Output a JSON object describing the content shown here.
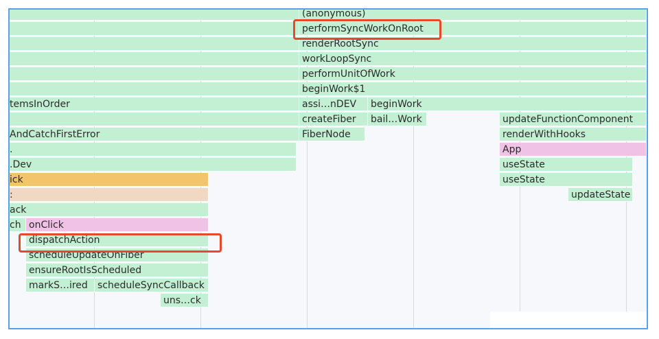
{
  "flame_chart": {
    "frames": {
      "anonymous": "(anonymous)",
      "performSyncWorkOnRoot": "performSyncWorkOnRoot",
      "renderRootSync": "renderRootSync",
      "workLoopSync": "workLoopSync",
      "performUnitOfWork": "performUnitOfWork",
      "beginWork1": "beginWork$1",
      "itemsInOrder": "temsInOrder",
      "assiNDEV": "assi…nDEV",
      "beginWork": "beginWork",
      "andCatchFirstError": "AndCatchFirstError",
      "createFiber": "createFiber",
      "bailWork": "bail…Work",
      "updateFunctionComponent": "updateFunctionComponent",
      "fiberNode": "FiberNode",
      "renderWithHooks": "renderWithHooks",
      "dotTruncated": ".",
      "app": "App",
      "dev": ".Dev",
      "useState1": "useState",
      "ick": "ick",
      "useState2": "useState",
      "colonTruncated": ":",
      "updateState": "updateState",
      "ack": "ack",
      "ch": "ch",
      "onClick": "onClick",
      "dispatchAction": "dispatchAction",
      "scheduleUpdateOnFiber": "scheduleUpdateOnFiber",
      "ensureRootIsScheduled": "ensureRootIsScheduled",
      "markSIred": "markS…ired",
      "scheduleSyncCallback": "scheduleSyncCallback",
      "unsCk": "uns…ck"
    },
    "highlighted_frames": [
      "performSyncWorkOnRoot",
      "dispatchAction"
    ],
    "colors": {
      "frame_green": "#c3efd3",
      "frame_pink": "#f0c2e6",
      "frame_orange": "#f2c56a",
      "frame_peach": "#f1d8c2",
      "highlight": "#e8472b",
      "border": "#5aa0e6"
    }
  }
}
